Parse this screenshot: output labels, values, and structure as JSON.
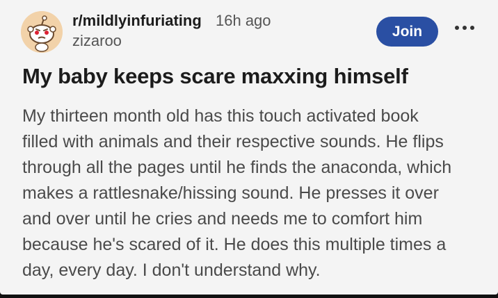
{
  "post": {
    "subreddit": "r/mildlyinfuriating",
    "time_ago": "16h ago",
    "username": "zizaroo",
    "join_label": "Join",
    "title": "My baby keeps scare maxxing himself",
    "body_lines": [
      "My thirteen month old has this touch activated book",
      "filled with animals and their respective sounds. He flips",
      "through all the pages until he finds the anaconda, which",
      "makes a rattlesnake/hissing sound. He presses it over",
      "and over until he cries and needs me to comfort him",
      "because he's scared of it. He does this multiple times a",
      "day, every day. I don't understand why."
    ]
  },
  "icons": {
    "avatar": "subreddit-avatar-icon",
    "more": "more-options-icon"
  },
  "colors": {
    "join_button": "#2a4fa3",
    "background": "#f4f4f4"
  }
}
